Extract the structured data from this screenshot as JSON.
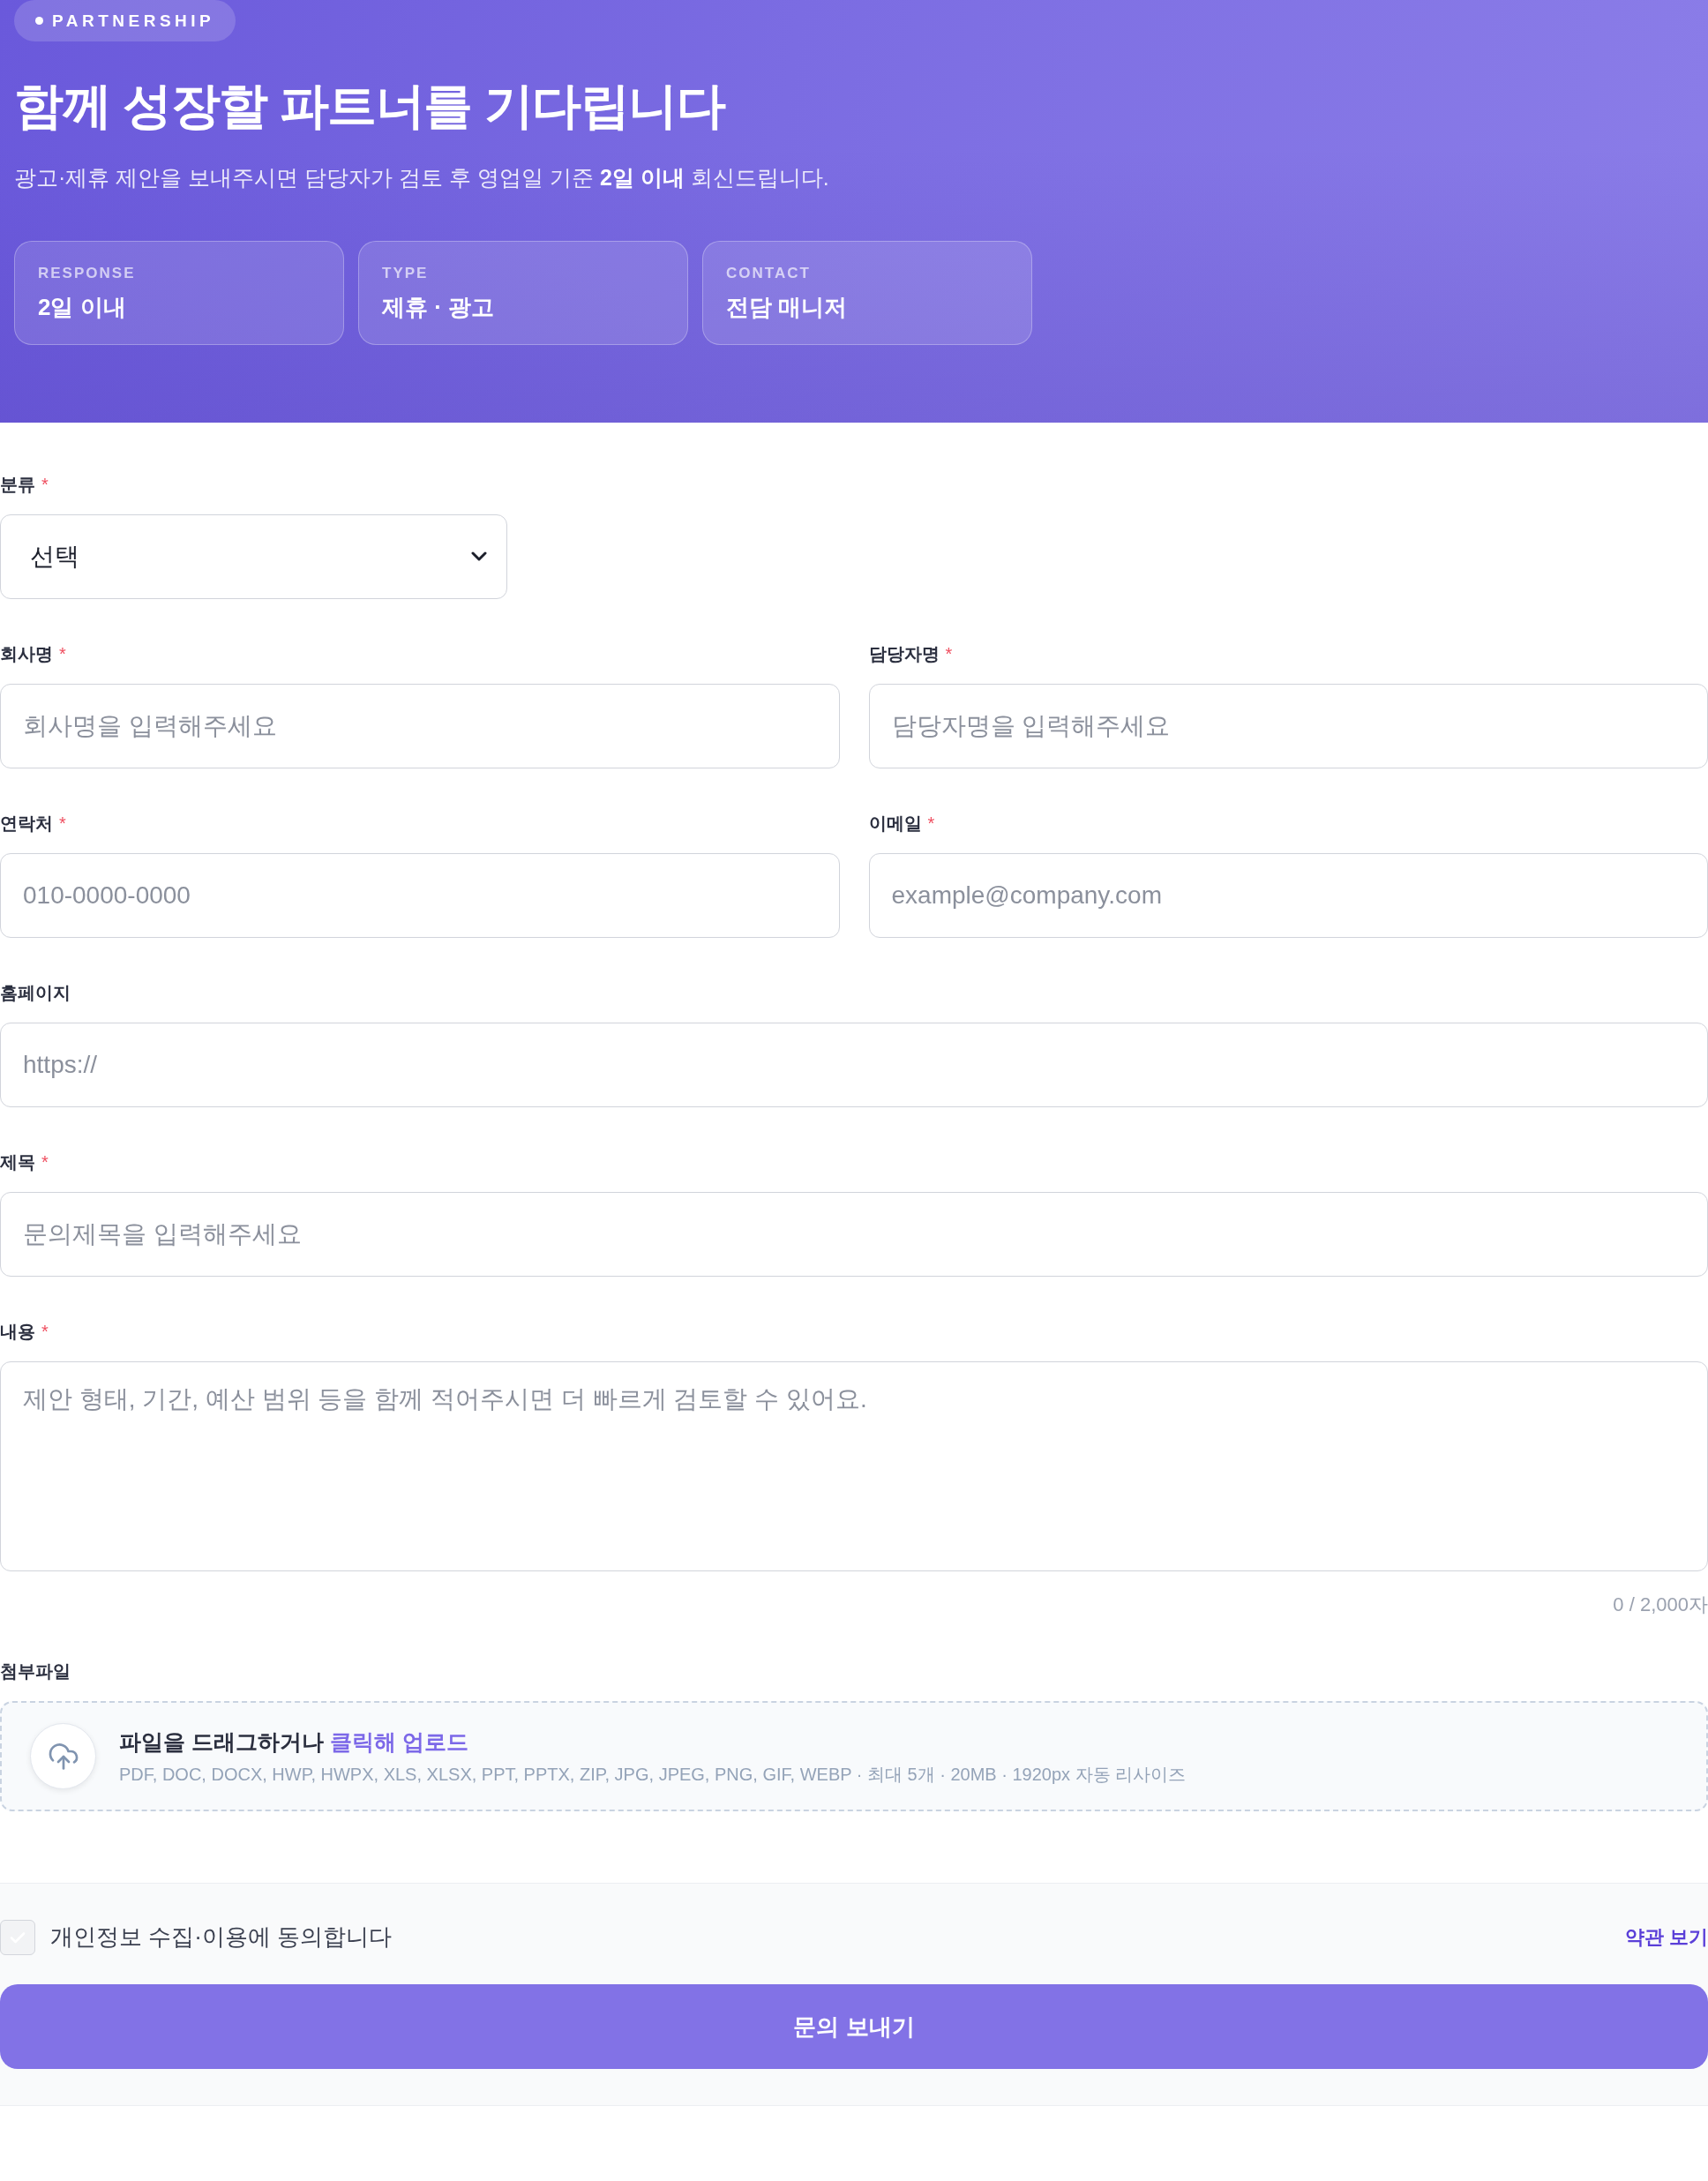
{
  "hero": {
    "badge": "PARTNERSHIP",
    "title": "함께 성장할 파트너를 기다립니다",
    "subtitle": "광고·제휴 제안을 보내주시면 담당자가 검토 후 영업일 기준 **2일 이내** 회신드립니다.",
    "stats": [
      {
        "label": "RESPONSE",
        "value": "2일 이내"
      },
      {
        "label": "TYPE",
        "value": "제휴 · 광고"
      },
      {
        "label": "CONTACT",
        "value": "전담 매니저"
      }
    ]
  },
  "form": {
    "rows": [
      [
        {
          "kind": "select",
          "label": "분류",
          "required_mark": "*",
          "value": "선택"
        }
      ],
      [
        {
          "kind": "text",
          "label": "회사명",
          "required_mark": "*",
          "placeholder": "회사명을 입력해주세요"
        },
        {
          "kind": "text",
          "label": "담당자명",
          "required_mark": "*",
          "placeholder": "담당자명을 입력해주세요"
        }
      ],
      [
        {
          "kind": "text",
          "label": "연락처",
          "required_mark": "*",
          "placeholder": "010-0000-0000"
        },
        {
          "kind": "text",
          "label": "이메일",
          "required_mark": "*",
          "placeholder": "example@company.com"
        }
      ],
      [
        {
          "kind": "text",
          "label": "홈페이지",
          "placeholder": "https://"
        }
      ],
      [
        {
          "kind": "text",
          "label": "제목",
          "required_mark": "*",
          "placeholder": "문의제목을 입력해주세요"
        }
      ],
      [
        {
          "kind": "textarea",
          "label": "내용",
          "required_mark": "*",
          "placeholder": "제안 형태, 기간, 예산 범위 등을 함께 적어주시면 더 빠르게 검토할 수 있어요.",
          "counter": "0 / 2,000자"
        }
      ],
      [
        {
          "kind": "upload",
          "label": "첨부파일",
          "prompt": "파일을 드래그하거나",
          "link": "클릭해 업로드",
          "hint": "PDF, DOC, DOCX, HWP, HWPX, XLS, XLSX, PPT, PPTX, ZIP, JPG, JPEG, PNG, GIF, WEBP · 최대 5개 · 20MB · 1920px 자동 리사이즈"
        }
      ]
    ]
  },
  "consent": {
    "checked": false,
    "label": "개인정보 수집·이용에 동의합니다",
    "terms_link": "약관 보기"
  },
  "submit": "문의 보내기"
}
